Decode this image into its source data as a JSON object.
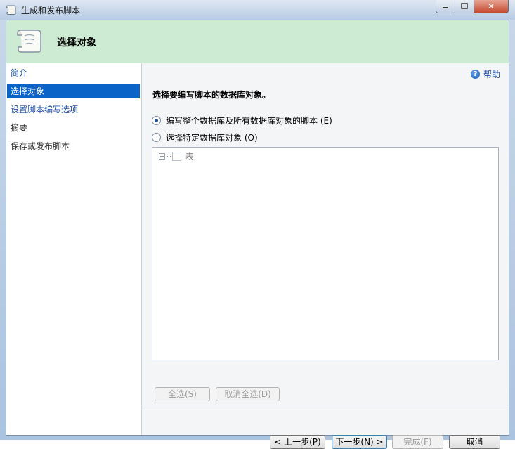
{
  "window": {
    "title": "生成和发布脚本",
    "controls": {
      "minimize": "minimize",
      "maximize": "maximize",
      "close": "✕"
    }
  },
  "header": {
    "title": "选择对象",
    "icon": "script-scroll-icon"
  },
  "nav": {
    "items": [
      {
        "label": "简介",
        "state": "link"
      },
      {
        "label": "选择对象",
        "state": "selected"
      },
      {
        "label": "设置脚本编写选项",
        "state": "link"
      },
      {
        "label": "摘要",
        "state": "plain"
      },
      {
        "label": "保存或发布脚本",
        "state": "plain"
      }
    ]
  },
  "content": {
    "help_label": "帮助",
    "prompt": "选择要编写脚本的数据库对象。",
    "options": [
      {
        "label": "编写整个数据库及所有数据库对象的脚本 (E)",
        "checked": true
      },
      {
        "label": "选择特定数据库对象 (O)",
        "checked": false
      }
    ],
    "tree": {
      "nodes": [
        {
          "label": "表",
          "expanded": false,
          "checked": false
        }
      ]
    },
    "select_all": "全选(S)",
    "deselect_all": "取消全选(D)"
  },
  "footer": {
    "previous": "< 上一步(P)",
    "next": "下一步(N) >",
    "finish": "完成(F)",
    "cancel": "取消"
  },
  "colors": {
    "header_bg": "#cdebd2",
    "selected_bg": "#0a64c8",
    "link": "#1f4fa8"
  }
}
